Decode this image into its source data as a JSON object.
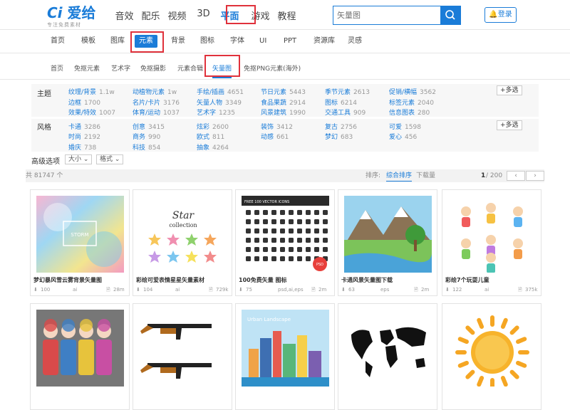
{
  "header": {
    "logo_text": "爱给",
    "logo_sub": "专注免费素材",
    "nav": [
      "音效",
      "配乐",
      "视频",
      "3D",
      "平面",
      "游戏",
      "教程"
    ],
    "search_placeholder": "矢量图",
    "login_label": "登录"
  },
  "subnav": [
    "首页",
    "模板",
    "图库",
    "元素",
    "背景",
    "图标",
    "字体",
    "UI",
    "PPT",
    "资源库",
    "灵感"
  ],
  "catnav": [
    "首页",
    "免抠元素",
    "艺术字",
    "免抠摄影",
    "元素合辑",
    "矢量图",
    "免抠PNG元素(海外)"
  ],
  "filters": {
    "theme_label": "主题",
    "theme_items": [
      {
        "name": "纹理/背景",
        "count": "1.1w"
      },
      {
        "name": "动植物元素",
        "count": "1w"
      },
      {
        "name": "手绘/插画",
        "count": "4651"
      },
      {
        "name": "节日元素",
        "count": "5443"
      },
      {
        "name": "季节元素",
        "count": "2613"
      },
      {
        "name": "促销/横幅",
        "count": "3562"
      },
      {
        "name": "边框",
        "count": "1700"
      },
      {
        "name": "名片/卡片",
        "count": "3176"
      },
      {
        "name": "矢量人物",
        "count": "3349"
      },
      {
        "name": "食品果蔬",
        "count": "2914"
      },
      {
        "name": "图标",
        "count": "6214"
      },
      {
        "name": "标签元素",
        "count": "2040"
      },
      {
        "name": "效果/特效",
        "count": "1007"
      },
      {
        "name": "体育/运动",
        "count": "1037"
      },
      {
        "name": "艺术字",
        "count": "1235"
      },
      {
        "name": "风景建筑",
        "count": "1990"
      },
      {
        "name": "交通工具",
        "count": "909"
      },
      {
        "name": "信息图表",
        "count": "280"
      }
    ],
    "style_label": "风格",
    "style_items": [
      {
        "name": "卡通",
        "count": "3286"
      },
      {
        "name": "创意",
        "count": "3415"
      },
      {
        "name": "炫彩",
        "count": "2600"
      },
      {
        "name": "装饰",
        "count": "3412"
      },
      {
        "name": "复古",
        "count": "2756"
      },
      {
        "name": "可爱",
        "count": "1598"
      },
      {
        "name": "时尚",
        "count": "2192"
      },
      {
        "name": "商务",
        "count": "990"
      },
      {
        "name": "欧式",
        "count": "811"
      },
      {
        "name": "动感",
        "count": "661"
      },
      {
        "name": "梦幻",
        "count": "683"
      },
      {
        "name": "爱心",
        "count": "456"
      },
      {
        "name": "婚庆",
        "count": "738"
      },
      {
        "name": "科技",
        "count": "854"
      },
      {
        "name": "抽象",
        "count": "4264"
      }
    ],
    "more_label": "+多选",
    "advanced_label": "高级选项",
    "size_select": "大小",
    "format_select": "格式"
  },
  "status": {
    "total": "共 81747 个",
    "sort_label": "排序:",
    "sort_default": "综合排序",
    "sort_downloads": "下载量",
    "page": "1",
    "page_total": "/ 200"
  },
  "cards": [
    {
      "title": "梦幻暴风雪云雾背景矢量图",
      "downloads": "100",
      "format": "ai",
      "size": "28m",
      "img_text": "STORM"
    },
    {
      "title": "彩绘可爱表情星星矢量素材",
      "downloads": "104",
      "format": "ai",
      "size": "729k",
      "img_text": "Star collection"
    },
    {
      "title": "100免费矢量 图标",
      "downloads": "75",
      "format": "psd,ai,eps",
      "size": "2m",
      "img_text": "FREE 100 VECTOR ICONS"
    },
    {
      "title": "卡通风景矢量图下载",
      "downloads": "63",
      "format": "eps",
      "size": "2m",
      "img_text": ""
    },
    {
      "title": "彩绘7个玩耍儿童",
      "downloads": "122",
      "format": "ai",
      "size": "375k",
      "img_text": ""
    },
    {
      "title": "",
      "downloads": "",
      "format": "",
      "size": "",
      "img_text": ""
    },
    {
      "title": "",
      "downloads": "",
      "format": "",
      "size": "",
      "img_text": ""
    },
    {
      "title": "",
      "downloads": "",
      "format": "",
      "size": "",
      "img_text": "Urban Landscape"
    },
    {
      "title": "",
      "downloads": "",
      "format": "",
      "size": "",
      "img_text": ""
    },
    {
      "title": "",
      "downloads": "",
      "format": "",
      "size": "",
      "img_text": ""
    }
  ],
  "colors": {
    "accent": "#1a7cd8",
    "highlight_box": "#e0313b"
  }
}
